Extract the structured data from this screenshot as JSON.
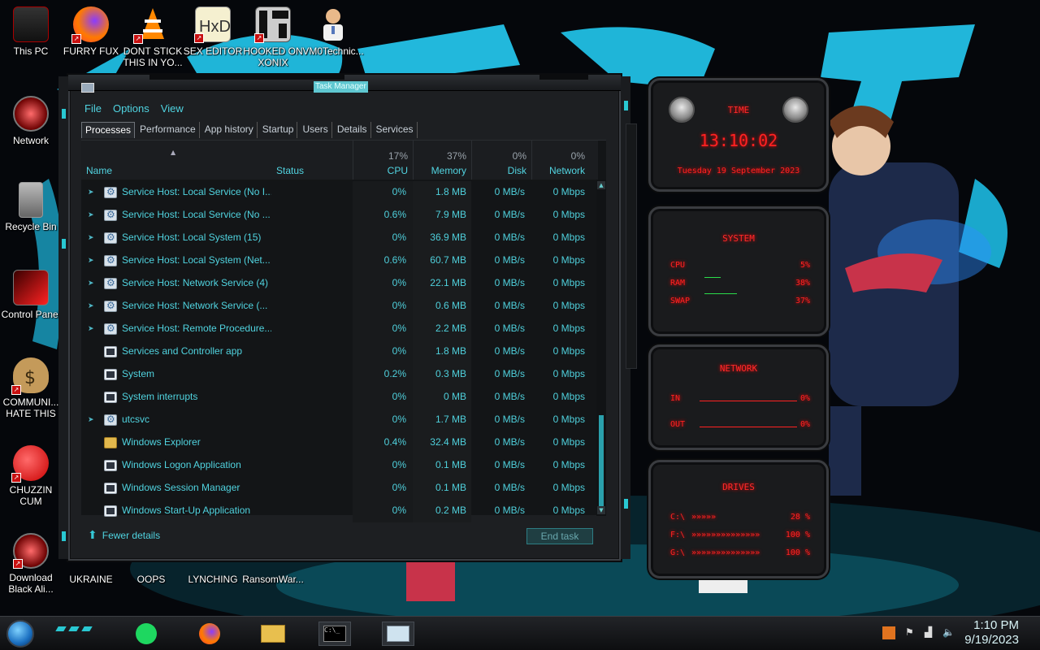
{
  "desktop": {
    "icons": [
      {
        "label": "This PC"
      },
      {
        "label": "FURRY FUX"
      },
      {
        "label": "DONT STICK THIS IN YO..."
      },
      {
        "label": "SEX EDITOR"
      },
      {
        "label": "HOOKED ON XONIX"
      },
      {
        "label": "VM0Technic..."
      },
      {
        "label": "Network"
      },
      {
        "label": "Recycle Bin"
      },
      {
        "label": "Control Panel"
      },
      {
        "label": "COMMUNI... HATE THIS"
      },
      {
        "label": "CHUZZIN CUM"
      },
      {
        "label": "Download Black Ali..."
      },
      {
        "label": "UKRAINE"
      },
      {
        "label": "OOPS"
      },
      {
        "label": "LYNCHING"
      },
      {
        "label": "RansomWar..."
      }
    ]
  },
  "task_manager": {
    "title": "Task Manager",
    "menu": [
      "File",
      "Options",
      "View"
    ],
    "tabs": [
      "Processes",
      "Performance",
      "App history",
      "Startup",
      "Users",
      "Details",
      "Services"
    ],
    "active_tab": "Processes",
    "columns": {
      "name": "Name",
      "status": "Status",
      "cpu": {
        "label": "CPU",
        "pct": "17%"
      },
      "memory": {
        "label": "Memory",
        "pct": "37%"
      },
      "disk": {
        "label": "Disk",
        "pct": "0%"
      },
      "network": {
        "label": "Network",
        "pct": "0%"
      }
    },
    "rows": [
      {
        "name": "Service Host: Local Service (No I...",
        "cpu": "0%",
        "memory": "1.8 MB",
        "disk": "0 MB/s",
        "network": "0 Mbps",
        "expandable": true,
        "icon": "gear"
      },
      {
        "name": "Service Host: Local Service (No ...",
        "cpu": "0.6%",
        "memory": "7.9 MB",
        "disk": "0 MB/s",
        "network": "0 Mbps",
        "expandable": true,
        "icon": "gear"
      },
      {
        "name": "Service Host: Local System (15)",
        "cpu": "0%",
        "memory": "36.9 MB",
        "disk": "0 MB/s",
        "network": "0 Mbps",
        "expandable": true,
        "icon": "gear"
      },
      {
        "name": "Service Host: Local System (Net...",
        "cpu": "0.6%",
        "memory": "60.7 MB",
        "disk": "0 MB/s",
        "network": "0 Mbps",
        "expandable": true,
        "icon": "gear"
      },
      {
        "name": "Service Host: Network Service (4)",
        "cpu": "0%",
        "memory": "22.1 MB",
        "disk": "0 MB/s",
        "network": "0 Mbps",
        "expandable": true,
        "icon": "gear"
      },
      {
        "name": "Service Host: Network Service (...",
        "cpu": "0%",
        "memory": "0.6 MB",
        "disk": "0 MB/s",
        "network": "0 Mbps",
        "expandable": true,
        "icon": "gear"
      },
      {
        "name": "Service Host: Remote Procedure...",
        "cpu": "0%",
        "memory": "2.2 MB",
        "disk": "0 MB/s",
        "network": "0 Mbps",
        "expandable": true,
        "icon": "gear"
      },
      {
        "name": "Services and Controller app",
        "cpu": "0%",
        "memory": "1.8 MB",
        "disk": "0 MB/s",
        "network": "0 Mbps",
        "expandable": false,
        "icon": "window"
      },
      {
        "name": "System",
        "cpu": "0.2%",
        "memory": "0.3 MB",
        "disk": "0 MB/s",
        "network": "0 Mbps",
        "expandable": false,
        "icon": "window"
      },
      {
        "name": "System interrupts",
        "cpu": "0%",
        "memory": "0 MB",
        "disk": "0 MB/s",
        "network": "0 Mbps",
        "expandable": false,
        "icon": "window"
      },
      {
        "name": "utcsvc",
        "cpu": "0%",
        "memory": "1.7 MB",
        "disk": "0 MB/s",
        "network": "0 Mbps",
        "expandable": true,
        "icon": "gear"
      },
      {
        "name": "Windows Explorer",
        "cpu": "0.4%",
        "memory": "32.4 MB",
        "disk": "0 MB/s",
        "network": "0 Mbps",
        "expandable": false,
        "icon": "folder"
      },
      {
        "name": "Windows Logon Application",
        "cpu": "0%",
        "memory": "0.1 MB",
        "disk": "0 MB/s",
        "network": "0 Mbps",
        "expandable": false,
        "icon": "window"
      },
      {
        "name": "Windows Session Manager",
        "cpu": "0%",
        "memory": "0.1 MB",
        "disk": "0 MB/s",
        "network": "0 Mbps",
        "expandable": false,
        "icon": "window"
      },
      {
        "name": "Windows Start-Up Application",
        "cpu": "0%",
        "memory": "0.2 MB",
        "disk": "0 MB/s",
        "network": "0 Mbps",
        "expandable": false,
        "icon": "window"
      }
    ],
    "footer": {
      "fewer_details": "Fewer details",
      "end_task": "End task"
    }
  },
  "gadget": {
    "time": {
      "title": "TIME",
      "clock": "13:10:02",
      "date": "Tuesday 19 September 2023"
    },
    "system": {
      "title": "SYSTEM",
      "cpu_label": "CPU",
      "cpu_val": "5%",
      "ram_label": "RAM",
      "ram_val": "38%",
      "swap_label": "SWAP",
      "swap_val": "37%"
    },
    "network": {
      "title": "NETWORK",
      "in_label": "IN",
      "in_val": "0%",
      "out_label": "OUT",
      "out_val": "0%"
    },
    "drives": {
      "title": "DRIVES",
      "items": [
        {
          "label": "C:\\",
          "val": "28 %"
        },
        {
          "label": "F:\\",
          "val": "100 %"
        },
        {
          "label": "G:\\",
          "val": "100 %"
        }
      ]
    }
  },
  "taskbar": {
    "time": "1:10 PM",
    "date": "9/19/2023"
  }
}
